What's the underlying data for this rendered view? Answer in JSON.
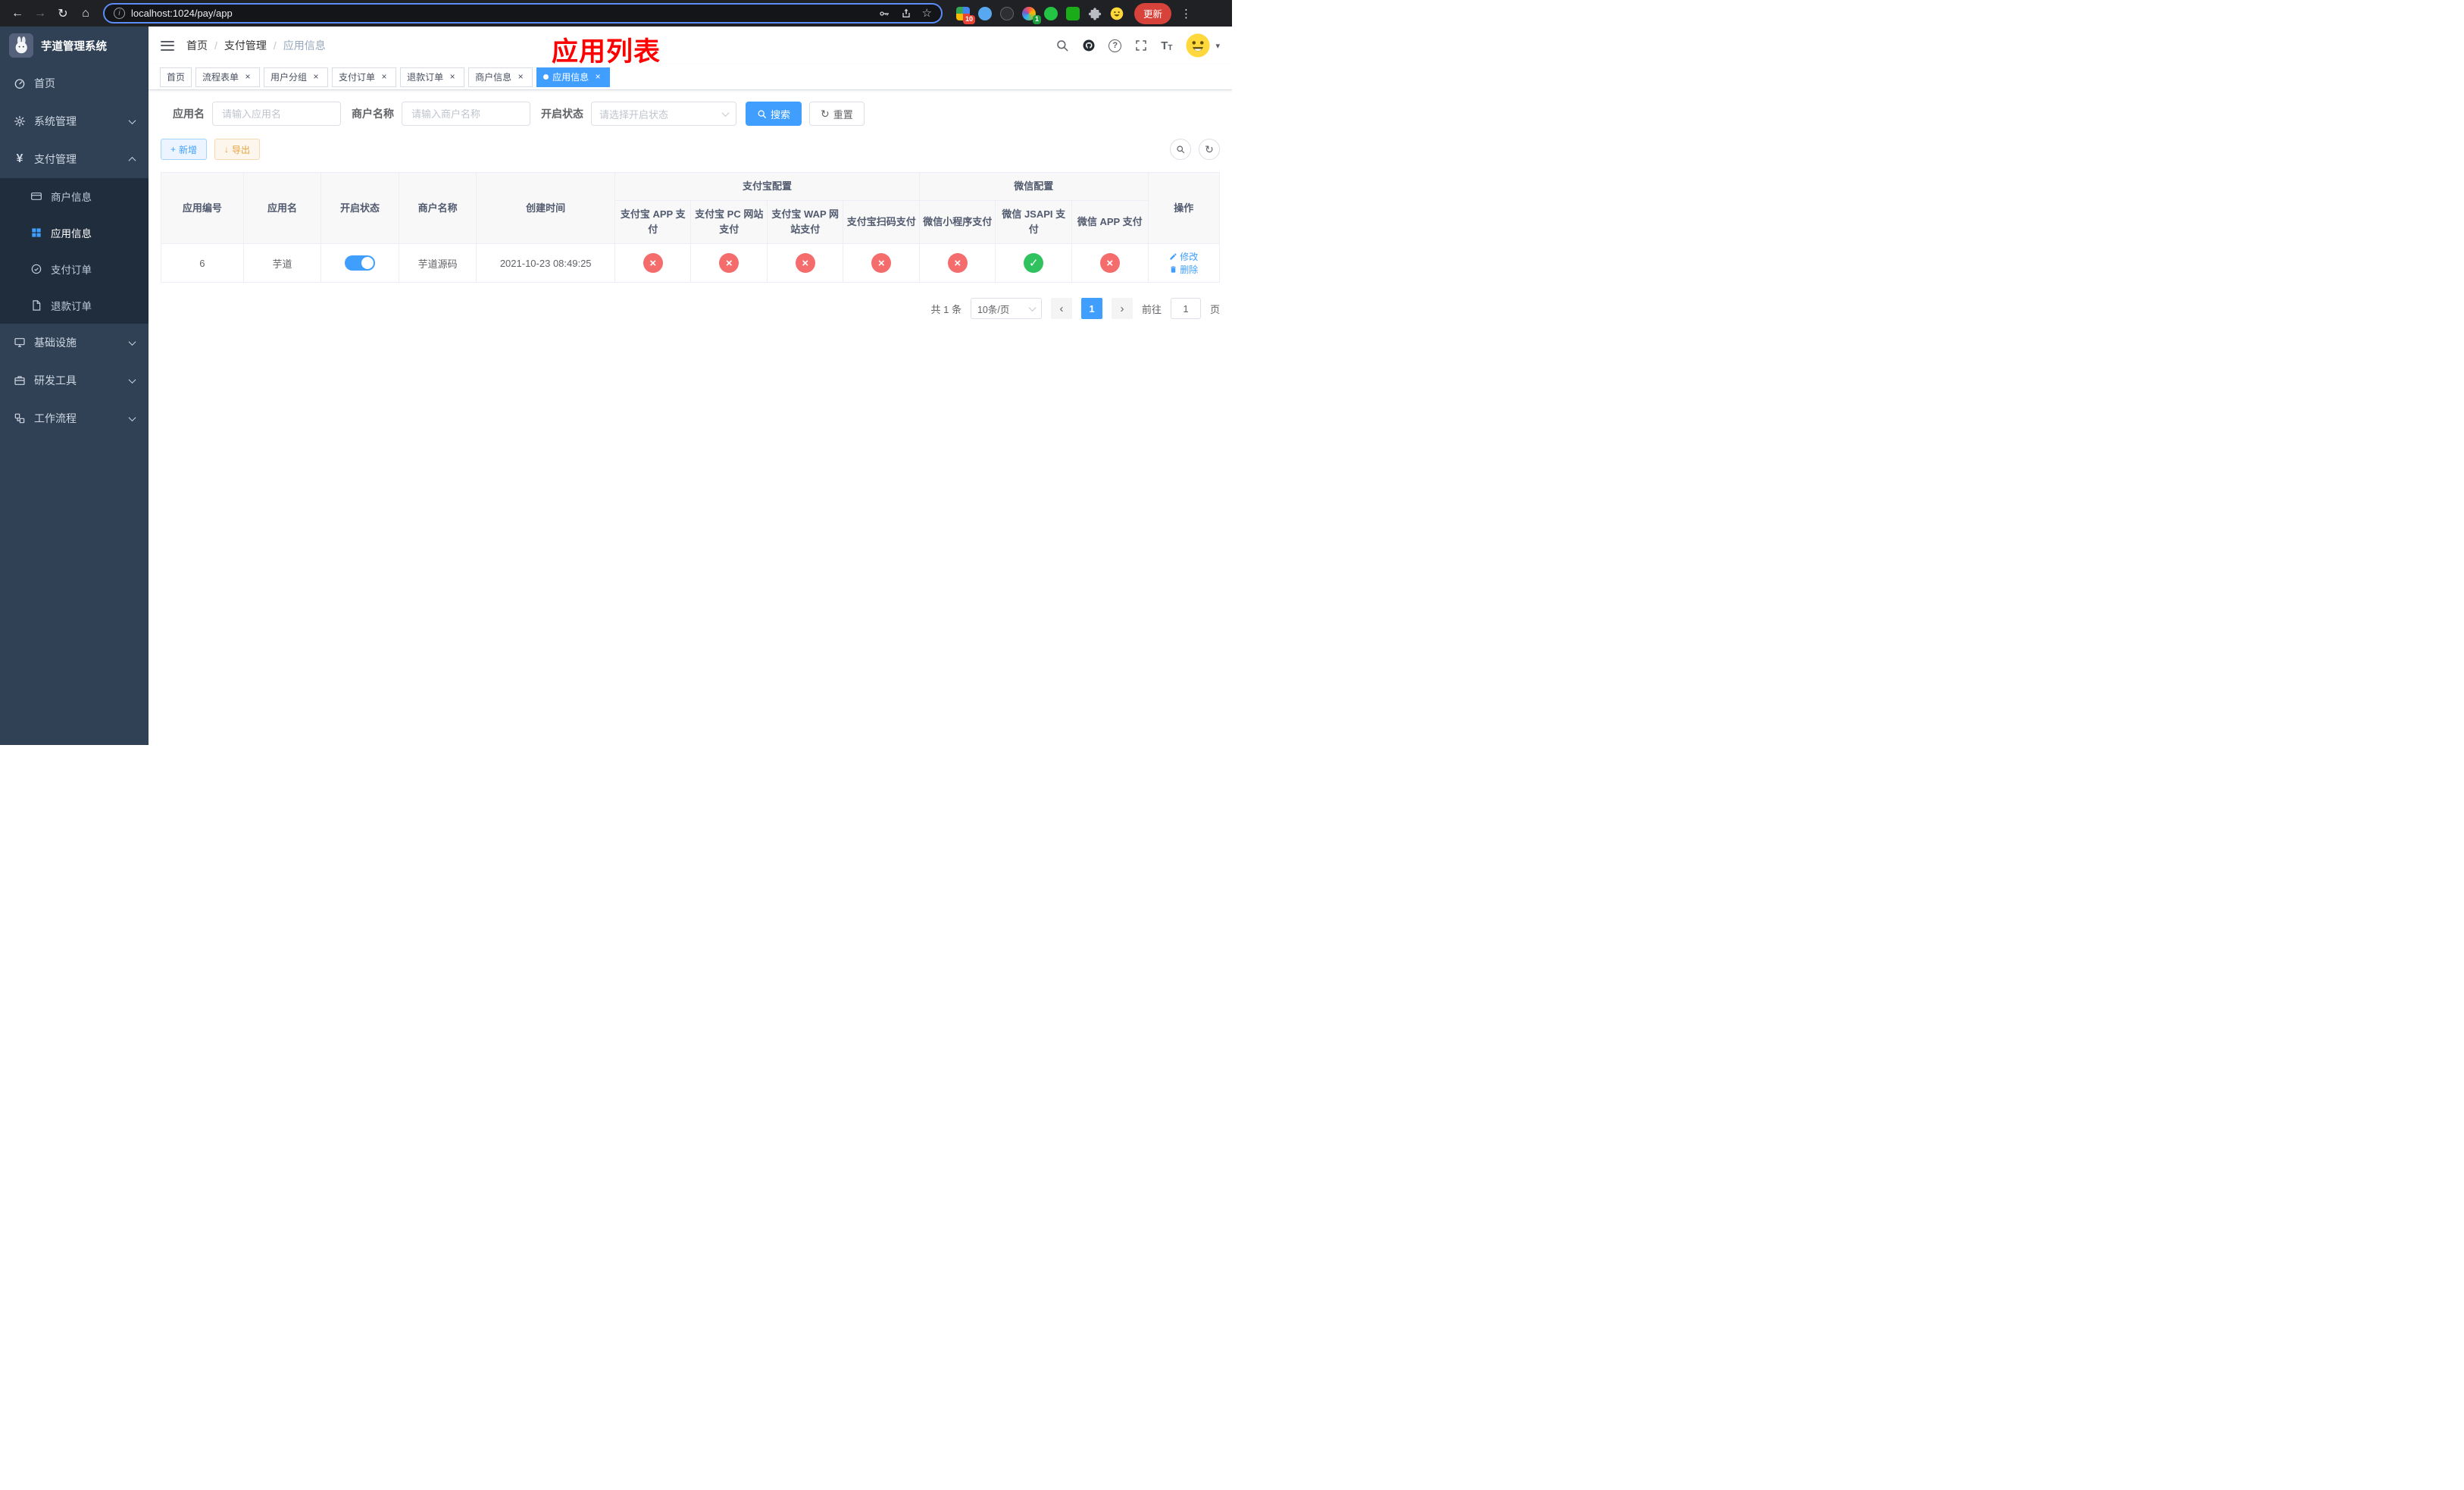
{
  "colors": {
    "accent": "#409eff",
    "danger": "#f56c6c",
    "success": "#2fc25e",
    "warning": "#e6a23c",
    "sidebar_bg": "#304156",
    "submenu_bg": "#1f2d3d"
  },
  "icons": {
    "back": "←",
    "forward": "→",
    "reload": "↻",
    "home": "⌂",
    "info": "i",
    "star": "☆",
    "menu_dots": "⋮",
    "close": "×",
    "plus": "+",
    "download": "↓",
    "check": "✓",
    "cross": "×",
    "prev": "‹",
    "next": "›",
    "refresh": "↻",
    "question": "?",
    "font_big": "T",
    "font_small": "T",
    "caret": "▾"
  },
  "browser": {
    "url": "localhost:1024/pay/app",
    "update_label": "更新",
    "ext_badge_red": "10",
    "ext_badge_green": "1"
  },
  "sidebar": {
    "title": "芋道管理系统",
    "items": [
      {
        "label": "首页"
      },
      {
        "label": "系统管理"
      },
      {
        "label": "支付管理"
      },
      {
        "label": "基础设施"
      },
      {
        "label": "研发工具"
      },
      {
        "label": "工作流程"
      }
    ],
    "payment_submenu": [
      {
        "label": "商户信息"
      },
      {
        "label": "应用信息"
      },
      {
        "label": "支付订单"
      },
      {
        "label": "退款订单"
      }
    ]
  },
  "breadcrumb": {
    "items": [
      "首页",
      "支付管理",
      "应用信息"
    ],
    "separator": "/"
  },
  "annotation": "应用列表",
  "tabs": [
    {
      "label": "首页"
    },
    {
      "label": "流程表单"
    },
    {
      "label": "用户分组"
    },
    {
      "label": "支付订单"
    },
    {
      "label": "退款订单"
    },
    {
      "label": "商户信息"
    },
    {
      "label": "应用信息"
    }
  ],
  "filters": {
    "app_name_label": "应用名",
    "app_name_placeholder": "请输入应用名",
    "merchant_label": "商户名称",
    "merchant_placeholder": "请输入商户名称",
    "status_label": "开启状态",
    "status_placeholder": "请选择开启状态",
    "search_label": "搜索",
    "reset_label": "重置"
  },
  "toolbar": {
    "add_label": "新增",
    "export_label": "导出"
  },
  "table": {
    "columns": {
      "id": "应用编号",
      "name": "应用名",
      "status": "开启状态",
      "merchant": "商户名称",
      "created": "创建时间",
      "ops": "操作"
    },
    "groups": {
      "alipay": "支付宝配置",
      "wechat": "微信配置"
    },
    "sub_columns": [
      "支付宝 APP 支付",
      "支付宝 PC 网站支付",
      "支付宝 WAP 网站支付",
      "支付宝扫码支付",
      "微信小程序支付",
      "微信 JSAPI 支付",
      "微信 APP 支付"
    ],
    "rows": [
      {
        "id": "6",
        "name": "芋道",
        "status_on": true,
        "merchant": "芋道源码",
        "created": "2021-10-23 08:49:25",
        "configs": [
          "cross",
          "cross",
          "cross",
          "cross",
          "cross",
          "check",
          "cross"
        ],
        "edit_label": "修改",
        "delete_label": "删除"
      }
    ]
  },
  "pagination": {
    "total": "共 1 条",
    "page_size": "10条/页",
    "page": "1",
    "goto_prefix": "前往",
    "goto_suffix": "页",
    "goto_value": "1"
  }
}
